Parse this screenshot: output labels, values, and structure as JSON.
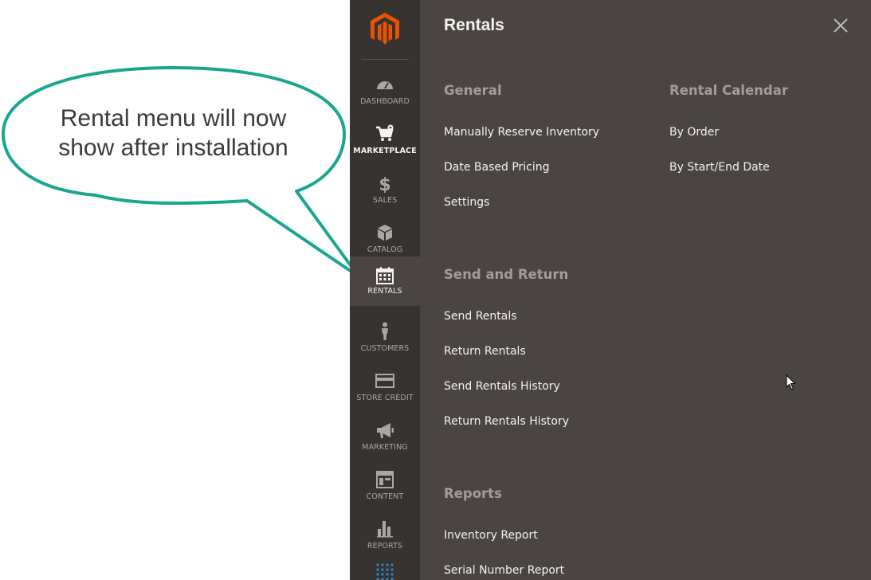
{
  "callout": {
    "line1": "Rental menu will now",
    "line2": "show after installation",
    "border_color": "#1aa58f"
  },
  "sidebar": {
    "logo": "magento-logo-icon",
    "items": [
      {
        "label": "DASHBOARD",
        "icon": "gauge-icon"
      },
      {
        "label": "MARKETPLACE",
        "icon": "cart-icon"
      },
      {
        "label": "SALES",
        "icon": "dollar-icon"
      },
      {
        "label": "CATALOG",
        "icon": "box-icon"
      },
      {
        "label": "RENTALS",
        "icon": "calendar-icon",
        "active": true
      },
      {
        "label": "CUSTOMERS",
        "icon": "person-icon"
      },
      {
        "label": "STORE CREDIT",
        "icon": "credit-card-icon"
      },
      {
        "label": "MARKETING",
        "icon": "megaphone-icon"
      },
      {
        "label": "CONTENT",
        "icon": "layout-icon"
      },
      {
        "label": "REPORTS",
        "icon": "bar-chart-icon"
      }
    ]
  },
  "panel": {
    "title": "Rentals",
    "close": "close-icon",
    "sections": [
      {
        "title": "General",
        "links": [
          "Manually Reserve Inventory",
          "Date Based Pricing",
          "Settings"
        ]
      },
      {
        "title": "Rental Calendar",
        "links": [
          "By Order",
          "By Start/End Date"
        ]
      },
      {
        "title": "Send and Return",
        "links": [
          "Send Rentals",
          "Return Rentals",
          "Send Rentals History",
          "Return Rentals History"
        ]
      },
      {
        "title": "Reports",
        "links": [
          "Inventory Report",
          "Serial Number Report"
        ]
      }
    ]
  },
  "colors": {
    "sidebar_bg": "#373330",
    "panel_bg": "#4a4542",
    "accent": "#eb5202"
  }
}
